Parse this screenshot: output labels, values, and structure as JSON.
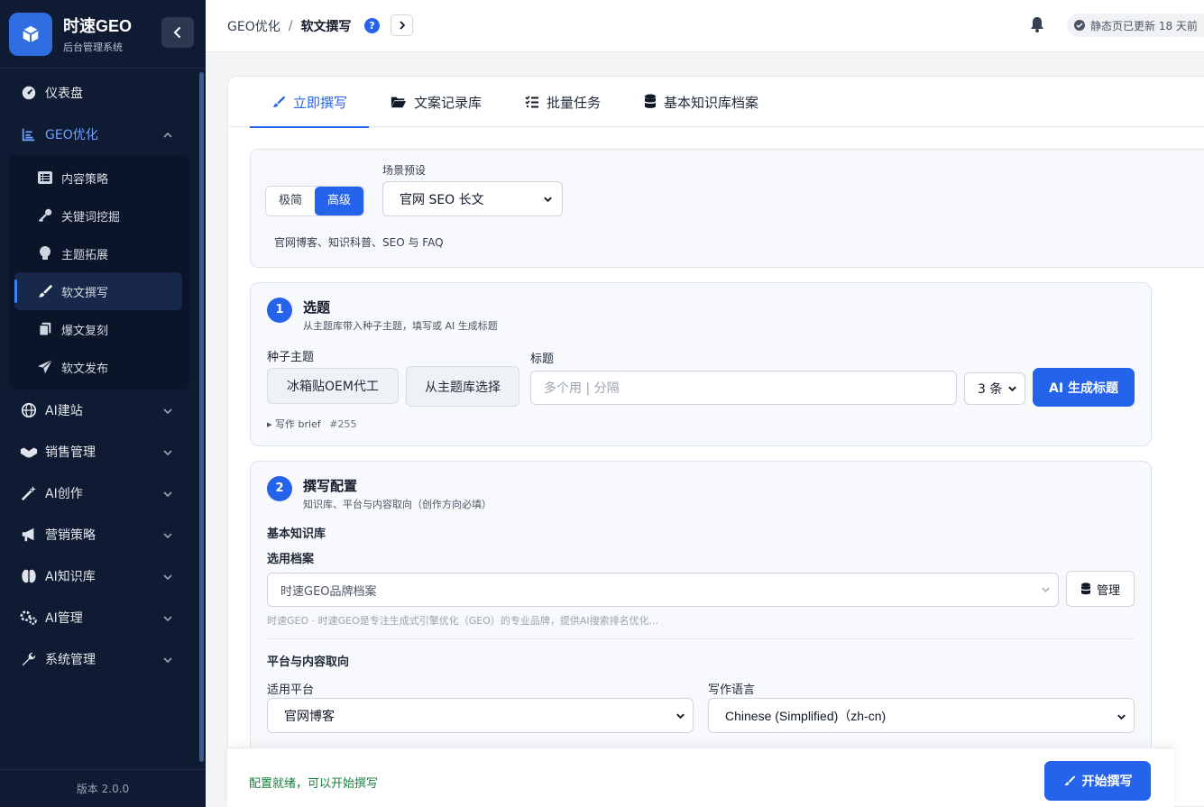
{
  "brand": {
    "title": "时速GEO",
    "subtitle": "后台管理系统"
  },
  "sidebar": {
    "items": [
      {
        "label": "仪表盘",
        "icon": "dashboard-icon"
      },
      {
        "label": "GEO优化",
        "icon": "chart-icon",
        "expanded": true
      },
      {
        "label": "AI建站",
        "icon": "globe-icon"
      },
      {
        "label": "销售管理",
        "icon": "handshake-icon"
      },
      {
        "label": "AI创作",
        "icon": "magic-wand-icon"
      },
      {
        "label": "营销策略",
        "icon": "megaphone-icon"
      },
      {
        "label": "AI知识库",
        "icon": "brain-icon"
      },
      {
        "label": "AI管理",
        "icon": "gears-icon"
      },
      {
        "label": "系统管理",
        "icon": "wrench-icon"
      }
    ],
    "sub_items": [
      {
        "label": "内容策略",
        "icon": "list-icon"
      },
      {
        "label": "关键词挖掘",
        "icon": "key-icon"
      },
      {
        "label": "主题拓展",
        "icon": "lightbulb-icon"
      },
      {
        "label": "软文撰写",
        "icon": "brush-icon",
        "active": true
      },
      {
        "label": "爆文复刻",
        "icon": "copy-icon"
      },
      {
        "label": "软文发布",
        "icon": "send-icon"
      }
    ],
    "version": "版本 2.0.0"
  },
  "topbar": {
    "breadcrumb_parent": "GEO优化",
    "breadcrumb_sep": "/",
    "breadcrumb_current": "软文撰写",
    "help": "?",
    "status": "静态页已更新 18 天前"
  },
  "tabs": [
    {
      "label": "立即撰写",
      "active": true
    },
    {
      "label": "文案记录库"
    },
    {
      "label": "批量任务"
    },
    {
      "label": "基本知识库档案"
    }
  ],
  "mode": {
    "simple": "极简",
    "advanced": "高级",
    "scene_label": "场景预设",
    "scene_value": "官网 SEO 长文",
    "scene_desc": "官网博客、知识科普、SEO 与 FAQ"
  },
  "section1": {
    "number": "1",
    "title": "选题",
    "subtitle": "从主题库带入种子主题，填写或 AI 生成标题",
    "seed_label": "种子主题",
    "seed_value": "冰箱贴OEM代工",
    "pick_button": "从主题库选择",
    "title_label": "标题",
    "title_placeholder": "多个用 | 分隔",
    "count_value": "3 条",
    "ai_button": "AI 生成标题",
    "brief_label": "写作 brief",
    "brief_num": "#255"
  },
  "section2": {
    "number": "2",
    "title": "撰写配置",
    "subtitle": "知识库、平台与内容取向（创作方向必填）",
    "kb_heading": "基本知识库",
    "profile_label": "选用档案",
    "profile_value": "时速GEO品牌档案",
    "manage_button": "管理",
    "profile_hint": "时速GEO · 时速GEO是专注生成式引擎优化（GEO）的专业品牌，提供AI搜索排名优化...",
    "platform_heading": "平台与内容取向",
    "platform_label": "适用平台",
    "platform_value": "官网博客",
    "lang_label": "写作语言",
    "lang_value": "Chinese (Simplified)（zh-cn)"
  },
  "footer": {
    "ready": "配置就绪，可以开始撰写",
    "start_button": "开始撰写"
  },
  "colors": {
    "primary": "#2563eb",
    "sidebar_bg": "#0f1b33",
    "ready": "#15803d"
  }
}
